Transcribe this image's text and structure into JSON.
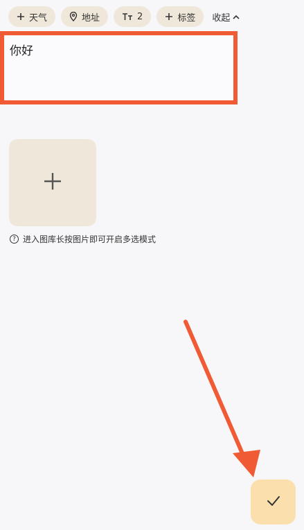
{
  "toolbar": {
    "weather_label": "天气",
    "address_label": "地址",
    "font_size_label": "2",
    "tag_label": "标签",
    "collapse_label": "收起"
  },
  "editor": {
    "content": "你好"
  },
  "gallery": {
    "hint_text": "进入图库长按图片即可开启多选模式"
  },
  "icons": {
    "weather": "plus-icon",
    "address": "location-pin-icon",
    "font": "text-size-icon",
    "tag": "plus-icon",
    "collapse": "chevron-up-icon",
    "add_image": "plus-icon",
    "hint": "question-circle-icon",
    "confirm": "checkmark-icon"
  },
  "colors": {
    "chip_bg": "#efe7da",
    "highlight_red": "#f05a34",
    "fab_bg": "#fbe0ae"
  }
}
